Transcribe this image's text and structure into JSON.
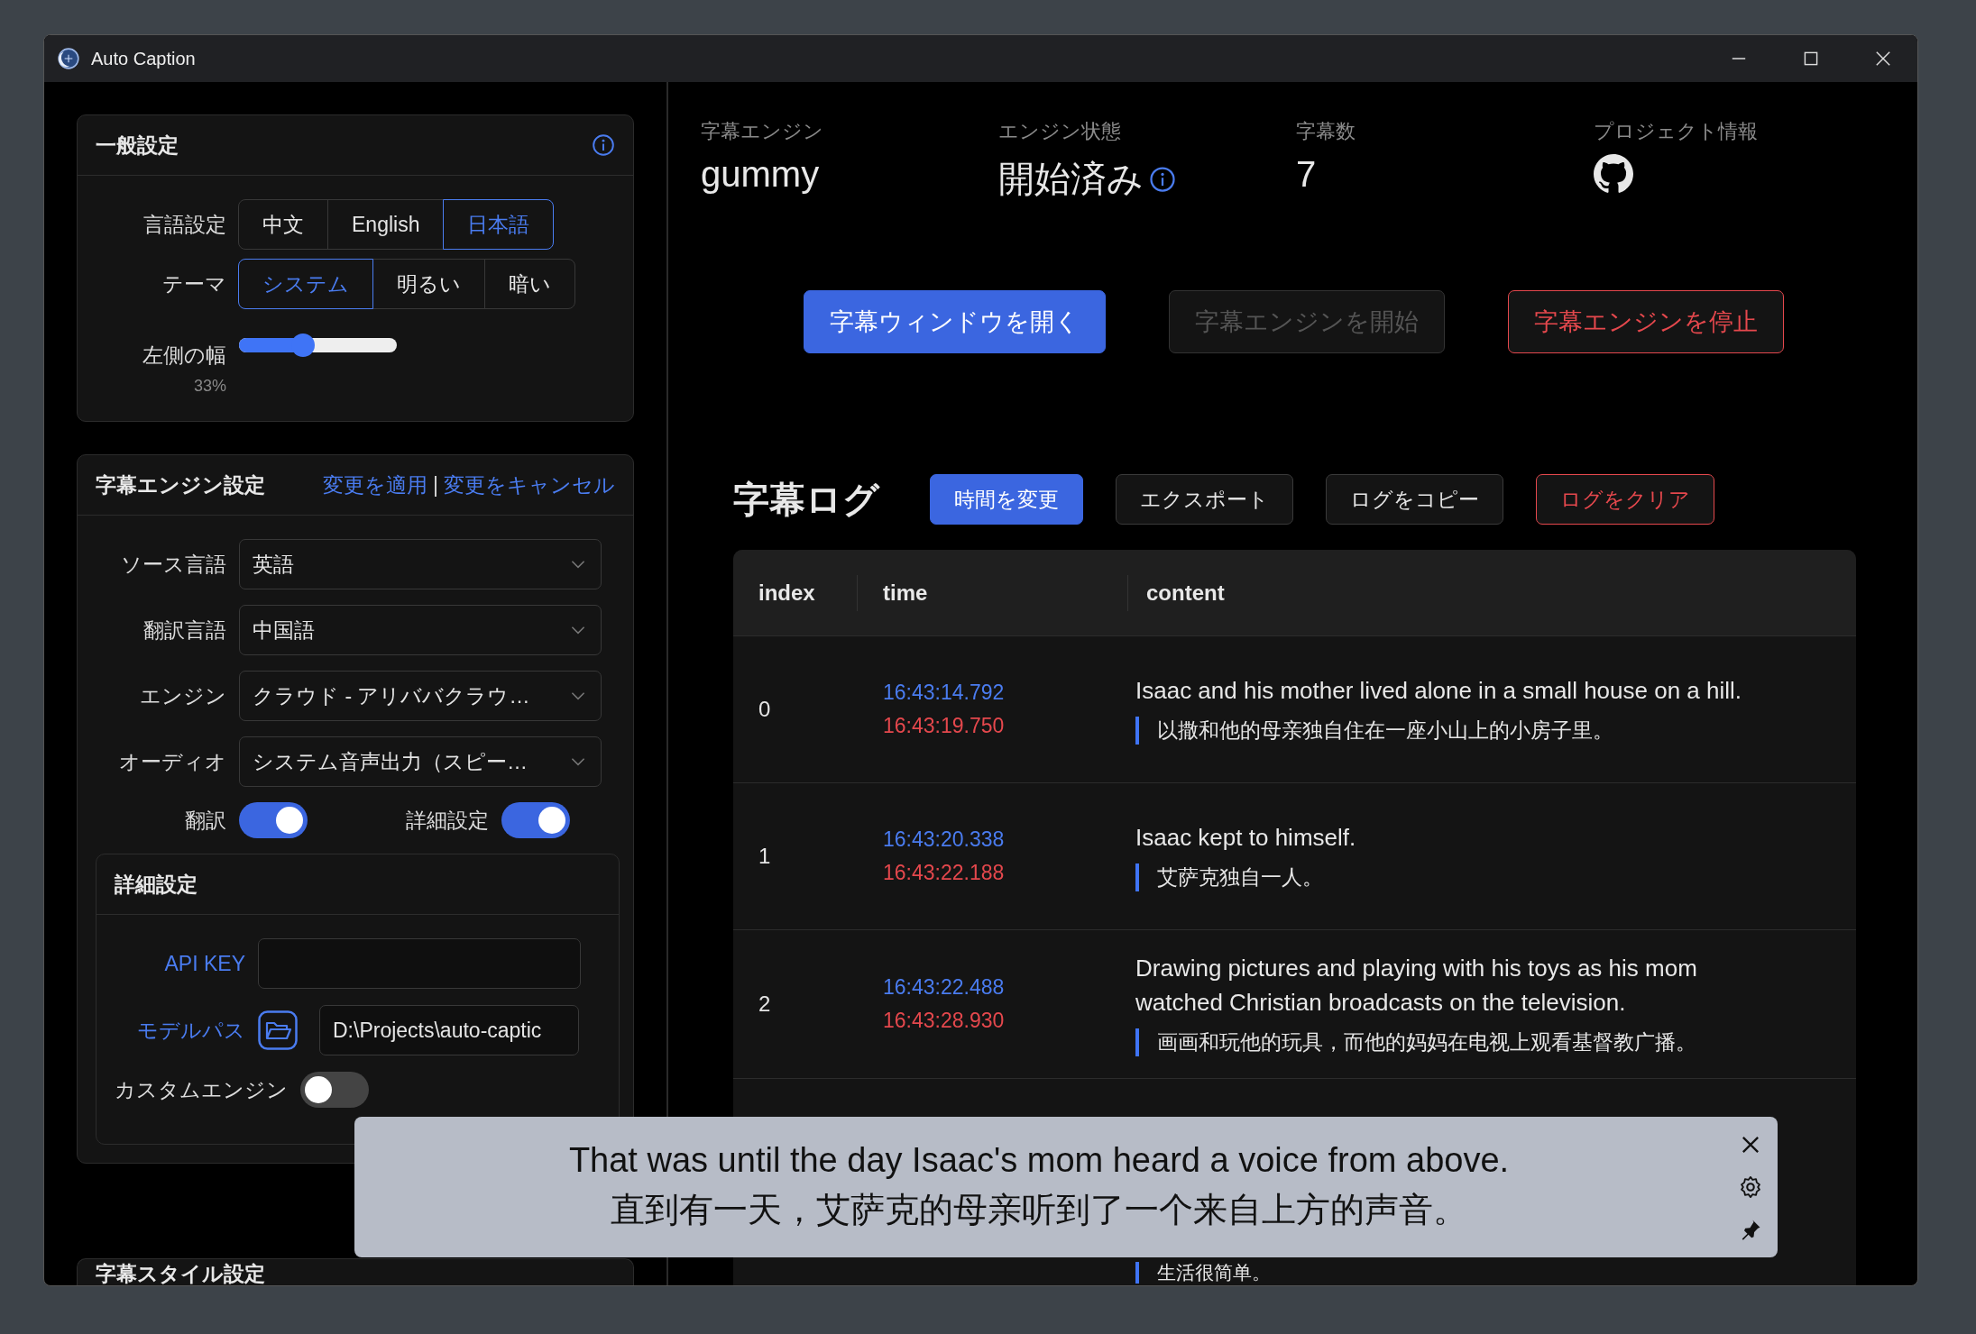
{
  "window": {
    "title": "Auto Caption"
  },
  "general_settings": {
    "title": "一般設定",
    "info": true,
    "language": {
      "label": "言語設定",
      "options": [
        {
          "label": "中文",
          "selected": false
        },
        {
          "label": "English",
          "selected": false
        },
        {
          "label": "日本語",
          "selected": true
        }
      ]
    },
    "theme": {
      "label": "テーマ",
      "options": [
        {
          "label": "システム",
          "selected": true
        },
        {
          "label": "明るい",
          "selected": false
        },
        {
          "label": "暗い",
          "selected": false
        }
      ]
    },
    "left_width": {
      "label": "左側の幅",
      "reading": "33%",
      "level": 0.39
    }
  },
  "engine_settings": {
    "title": "字幕エンジン設定",
    "links": [
      "変更を適用",
      "変更をキャンセル"
    ],
    "separator": "|",
    "selects": [
      {
        "label": "ソース言語",
        "value": "英語"
      },
      {
        "label": "翻訳言語",
        "value": "中国語"
      },
      {
        "label": "エンジン",
        "value": "クラウド - アリババクラウ…"
      },
      {
        "label": "オーディオ",
        "value": "システム音声出力（スピー…"
      }
    ],
    "switches": [
      {
        "label": "翻訳",
        "on": true
      },
      {
        "label": "詳細設定",
        "on": true
      }
    ],
    "advanced": {
      "title": "詳細設定",
      "api_key_label": "API KEY",
      "model_path": {
        "label": "モデルパス",
        "value": "D:\\Projects\\auto-captic"
      },
      "custom_engine": {
        "label": "カスタムエンジン",
        "on": false
      }
    }
  },
  "style_settings": {
    "title": "字幕スタイル設定"
  },
  "stats": [
    {
      "label": "字幕エンジン",
      "kind": "text",
      "value": "gummy",
      "info": false
    },
    {
      "label": "エンジン状態",
      "kind": "text",
      "value": "開始済み",
      "info": true
    },
    {
      "label": "字幕数",
      "kind": "text",
      "value": "7",
      "info": false
    },
    {
      "label": "プロジェクト情報",
      "kind": "logo",
      "info": false
    }
  ],
  "actions": [
    {
      "label": "字幕ウィンドウを開く",
      "kind": "primary"
    },
    {
      "label": "字幕エンジンを開始",
      "kind": "disabled"
    },
    {
      "label": "字幕エンジンを停止",
      "kind": "danger"
    }
  ],
  "log": {
    "title": "字幕ログ",
    "buttons": [
      {
        "label": "時間を変更",
        "kind": "primary"
      },
      {
        "label": "エクスポート",
        "kind": "default"
      },
      {
        "label": "ログをコピー",
        "kind": "default"
      },
      {
        "label": "ログをクリア",
        "kind": "danger"
      }
    ],
    "table": {
      "columns": [
        "index",
        "time",
        "content"
      ],
      "rows": [
        {
          "index": "0",
          "start": "16:43:14.792",
          "end": "16:43:19.750",
          "text": "Isaac and his mother lived alone in a small house on a hill.",
          "translation": "以撒和他的母亲独自住在一座小山上的小房子里。"
        },
        {
          "index": "1",
          "start": "16:43:20.338",
          "end": "16:43:22.188",
          "text": "Isaac kept to himself.",
          "translation": "艾萨克独自一人。"
        },
        {
          "index": "2",
          "start": "16:43:22.488",
          "end": "16:43:28.930",
          "text": "Drawing pictures and playing with his toys as his mom watched Christian broadcasts on the television.",
          "translation": "画画和玩他的玩具，而他的妈妈在电视上观看基督教广播。"
        },
        {
          "translation": "生活很简单。"
        }
      ]
    }
  },
  "caption_window": {
    "lines": [
      "That was until the day Isaac's mom heard a voice from above.",
      "直到有一天，艾萨克的母亲听到了一个来自上方的声音。"
    ]
  }
}
